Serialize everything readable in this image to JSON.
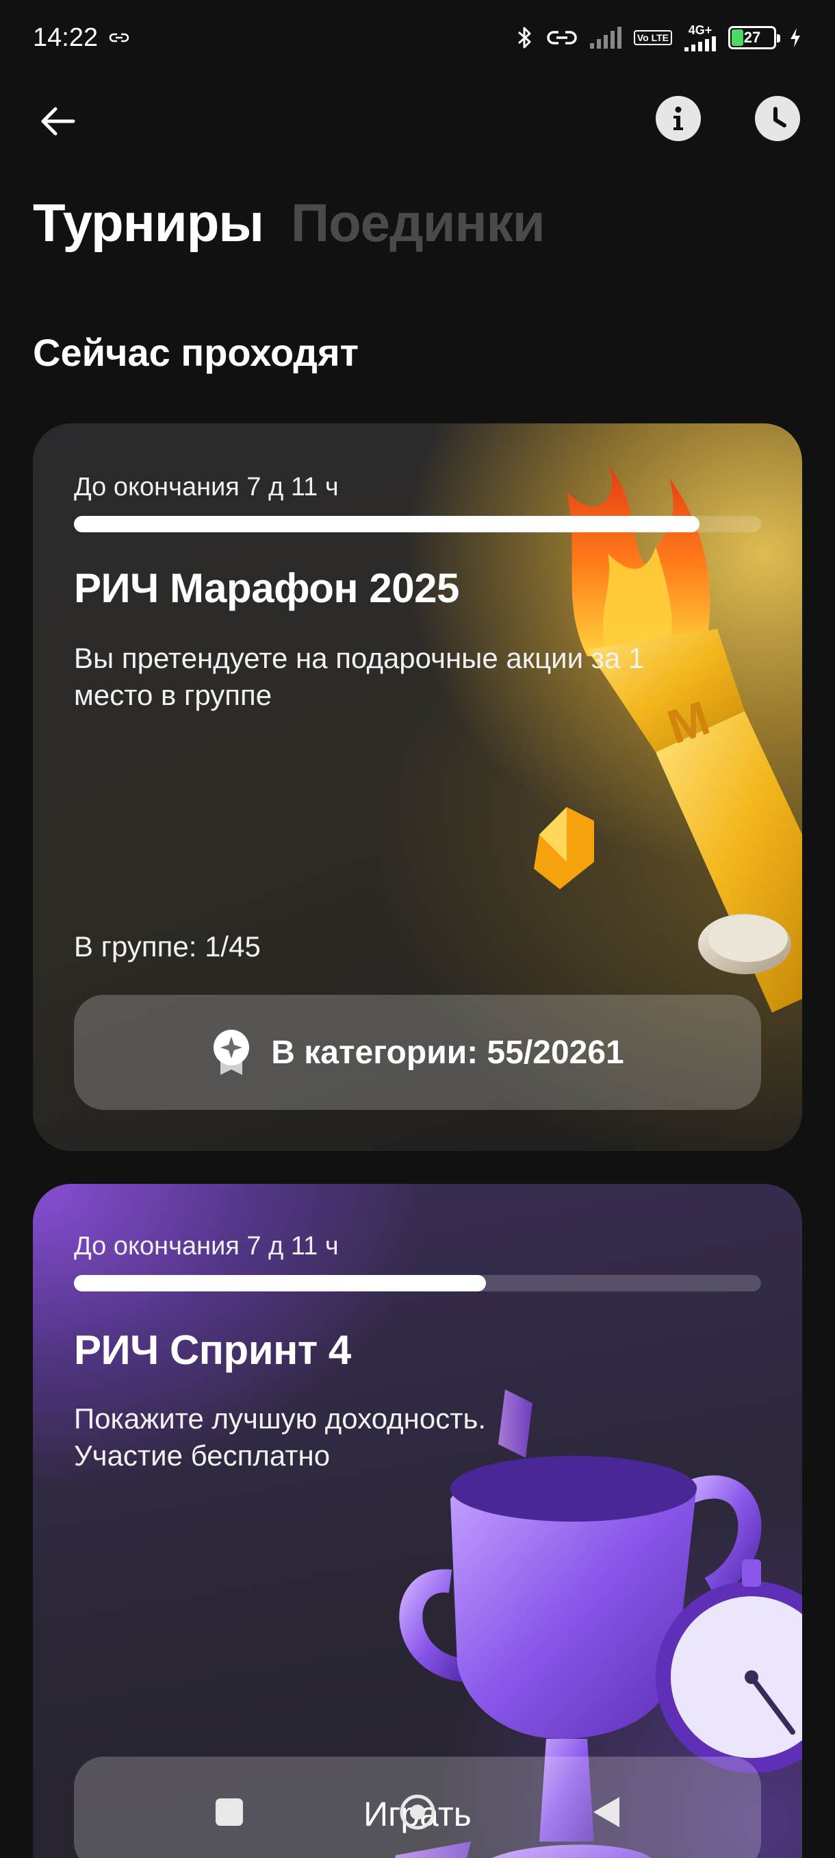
{
  "status_bar": {
    "time": "14:22",
    "network": "4G+",
    "volte": "Vo LTE",
    "battery": "27",
    "battery_level": 0.27
  },
  "header": {
    "back_icon": "arrow-left-icon",
    "info_icon": "info-icon",
    "history_icon": "clock-icon"
  },
  "tabs": [
    {
      "label": "Турниры",
      "active": true
    },
    {
      "label": "Поединки",
      "active": false
    }
  ],
  "section_title": "Сейчас проходят",
  "tournaments": [
    {
      "deadline": "До окончания 7 д 11 ч",
      "progress": 0.91,
      "title": "РИЧ Марафон 2025",
      "description": "Вы претендуете на подарочные акции за 1 место в группе",
      "group": "В группе: 1/45",
      "button_label": "В категории: 55/20261",
      "button_icon": "badge-star-icon",
      "accent": "#e8c454"
    },
    {
      "deadline": "До окончания 7 д 11 ч",
      "progress": 0.6,
      "title": "РИЧ Спринт 4",
      "description": "Покажите лучшую доходность. Участие бесплатно",
      "button_label": "Играть",
      "accent": "#8c50dc"
    }
  ],
  "nav_bar": {
    "recent_icon": "square-icon",
    "home_icon": "circle-icon",
    "back_icon": "triangle-back-icon"
  }
}
